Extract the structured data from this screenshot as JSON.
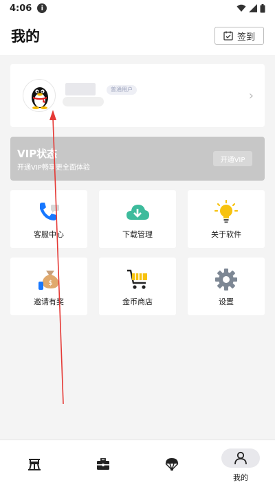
{
  "status_bar": {
    "time": "4:06",
    "info_icon": "i"
  },
  "header": {
    "title": "我的",
    "checkin_label": "签到"
  },
  "profile": {
    "badge": "普通用户",
    "chevron": "›"
  },
  "vip": {
    "title": "VIP状态",
    "subtitle": "开通VIP畅享更全面体验",
    "button": "开通VIP"
  },
  "tiles": [
    {
      "label": "客服中心",
      "icon": "customer-service-icon"
    },
    {
      "label": "下载管理",
      "icon": "cloud-download-icon"
    },
    {
      "label": "关于软件",
      "icon": "lightbulb-icon"
    },
    {
      "label": "邀请有奖",
      "icon": "money-bag-icon"
    },
    {
      "label": "金币商店",
      "icon": "shopping-cart-icon"
    },
    {
      "label": "设置",
      "icon": "gear-icon"
    }
  ],
  "bottom_nav": [
    {
      "icon": "home-icon",
      "label": ""
    },
    {
      "icon": "briefcase-icon",
      "label": ""
    },
    {
      "icon": "parachute-icon",
      "label": ""
    },
    {
      "icon": "person-icon",
      "label": "我的",
      "active": true
    }
  ],
  "colors": {
    "vip_bg": "#c7c7c7",
    "accent_blue": "#1677ff",
    "accent_green": "#3dbb9c",
    "accent_yellow": "#f7c20f",
    "arrow_red": "#e53935"
  }
}
